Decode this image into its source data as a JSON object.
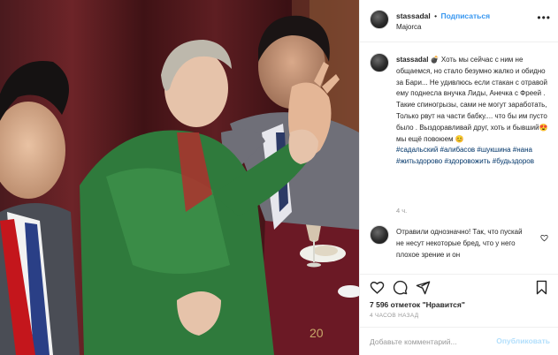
{
  "post": {
    "username": "stassadal",
    "follow_label": "Подписаться",
    "separator": "•",
    "location": "Majorca",
    "more_icon": "more-horizontal-icon"
  },
  "caption": {
    "username": "stassadal",
    "text": "💣 Хоть мы сейчас с ним не общаемся, но стало безумно жалко и обидно за Бари... Не удивлюсь если стакан с отравой ему поднесла внучка Лиды, Анечка с Фреей . Такие спиногрызы, сами не могут заработать, Только рвут на части бабку.... что бы им пусто было . Выздоравливай друг, хоть и бывший😍 мы ещё повоюем 😊",
    "hashtags": "#садальский #алибасов #шукшина #нана #житьздорово #здоровожить #будьздоров",
    "time": "4 ч."
  },
  "reply": {
    "text": "Отравили однозначно! Так, что пускай не несут некоторые бред, что у него плохое зрение и он"
  },
  "actions": {
    "like_icon": "heart-icon",
    "comment_icon": "comment-icon",
    "share_icon": "share-icon",
    "save_icon": "bookmark-icon"
  },
  "likes": {
    "count_text": "7 596 отметок",
    "like_word": "\"Нравится\""
  },
  "time_ago": "4 ЧАСОВ НАЗАД",
  "comment_box": {
    "placeholder": "Добавьте комментарий...",
    "publish_label": "Опубликовать"
  },
  "photo": {
    "table_number": "20"
  }
}
